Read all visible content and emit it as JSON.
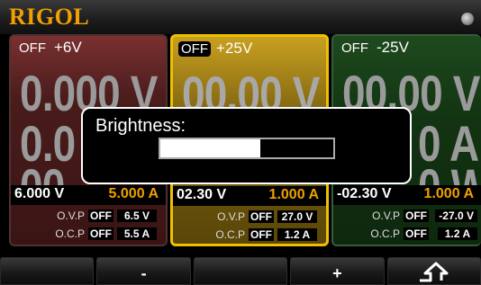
{
  "header": {
    "brand": "RIGOL",
    "status_icon": "status-light-icon"
  },
  "channels": [
    {
      "state": "OFF",
      "name": "+6V",
      "volt": "0.000 V",
      "curr": "0.0",
      "power": "00.",
      "set_v": "6.000 V",
      "set_a": "5.000 A",
      "ovp_label": "O.V.P",
      "ovp_state": "OFF",
      "ovp_val": "6.5 V",
      "ocp_label": "O.C.P",
      "ocp_state": "OFF",
      "ocp_val": "5.5 A",
      "color": "#5a2020"
    },
    {
      "state": "OFF",
      "name": "+25V",
      "volt": "00.00 V",
      "curr": "",
      "power": "",
      "set_v": "02.30 V",
      "set_a": "1.000 A",
      "ovp_label": "O.V.P",
      "ovp_state": "OFF",
      "ovp_val": "27.0 V",
      "ocp_label": "O.C.P",
      "ocp_state": "OFF",
      "ocp_val": "1.2 A",
      "color": "#f0c000"
    },
    {
      "state": "OFF",
      "name": "-25V",
      "volt": "00.00 V",
      "curr": "0 A",
      "power": "0 W",
      "set_v": "-02.30 V",
      "set_a": "1.000 A",
      "ovp_label": "O.V.P",
      "ovp_state": "OFF",
      "ovp_val": "-27.0 V",
      "ocp_label": "O.C.P",
      "ocp_state": "OFF",
      "ocp_val": "1.2 A",
      "color": "#1e4a1e"
    }
  ],
  "softkeys": [
    "",
    "-",
    "",
    "+",
    "return-arrow-icon"
  ],
  "dialog": {
    "title": "Brightness:",
    "level": 0.58
  },
  "colors": {
    "accent": "#f0a000",
    "ch2_border": "#f0c000"
  }
}
